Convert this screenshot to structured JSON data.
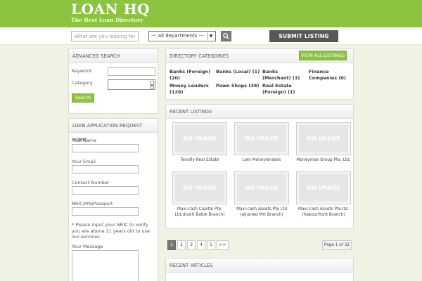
{
  "header": {
    "logo_title": "LOAN HQ",
    "logo_tagline": "The Best Loan Directory",
    "brand_color": "#8cc440"
  },
  "searchbar": {
    "search_placeholder": "What are you looking for?",
    "department_selected": "--- all departments ---",
    "search_icon": "magnifier-icon",
    "submit_label": "SUBMIT LISTING"
  },
  "advanced_search": {
    "title": "ADVANCED SEARCH",
    "keyword_label": "Keyword",
    "category_label": "Category",
    "search_button": "Search"
  },
  "loan_form": {
    "title": "LOAN APPLICATION REQUEST FORM",
    "name_label": "Your Name",
    "email_label": "Your Email",
    "contact_label": "Contact Number",
    "nric_label": "NRIC/FIN/Passport",
    "nric_note": "* Please input your NRIC to verify you are above 21 years old to use our services.",
    "message_label": "Your Message"
  },
  "directory": {
    "title": "DIRECTORY CATEGORIES",
    "view_all_button": "VIEW ALL LISTINGS",
    "categories": [
      {
        "line1": "Banks (Foreign)",
        "line2": "(20)"
      },
      {
        "line1": "Banks (Local) (1)",
        "line2": ""
      },
      {
        "line1": "Banks",
        "line2": "(Merchant) (3)"
      },
      {
        "line1": "Finance",
        "line2": "Companies (0)"
      },
      {
        "line1": "Money Lenders",
        "line2": "(126)"
      },
      {
        "line1": "Pawn Shops (38)",
        "line2": ""
      },
      {
        "line1": "Real Estate",
        "line2": "(Foreign) (1)"
      }
    ]
  },
  "recent_listings": {
    "title": "RECENT LISTINGS",
    "placeholder_text": "NO IMAGE",
    "items": [
      {
        "line1": "Tenafly Real Estate",
        "line2": ""
      },
      {
        "line1": "Lien Moneylenders",
        "line2": ""
      },
      {
        "line1": "Moneymax Group Pte. Ltd.",
        "line2": ""
      },
      {
        "line1": "Maxi-cash Capital Pte.",
        "line2": "Ltd.(bukit Batok Branch)"
      },
      {
        "line1": "Maxi-cash Assets Pte Ltd",
        "line2": "(aljunied Mrt Branch)"
      },
      {
        "line1": "Maxi-cash Assets Pte.ltd.",
        "line2": "(habourfront Branch)"
      }
    ]
  },
  "pagination": {
    "pages": [
      "1",
      "2",
      "3",
      "4",
      "5"
    ],
    "next_label": ">>",
    "current_page": 1,
    "info": "Page 1 of 32"
  },
  "recent_articles": {
    "title": "RECENT ARTICLES"
  }
}
